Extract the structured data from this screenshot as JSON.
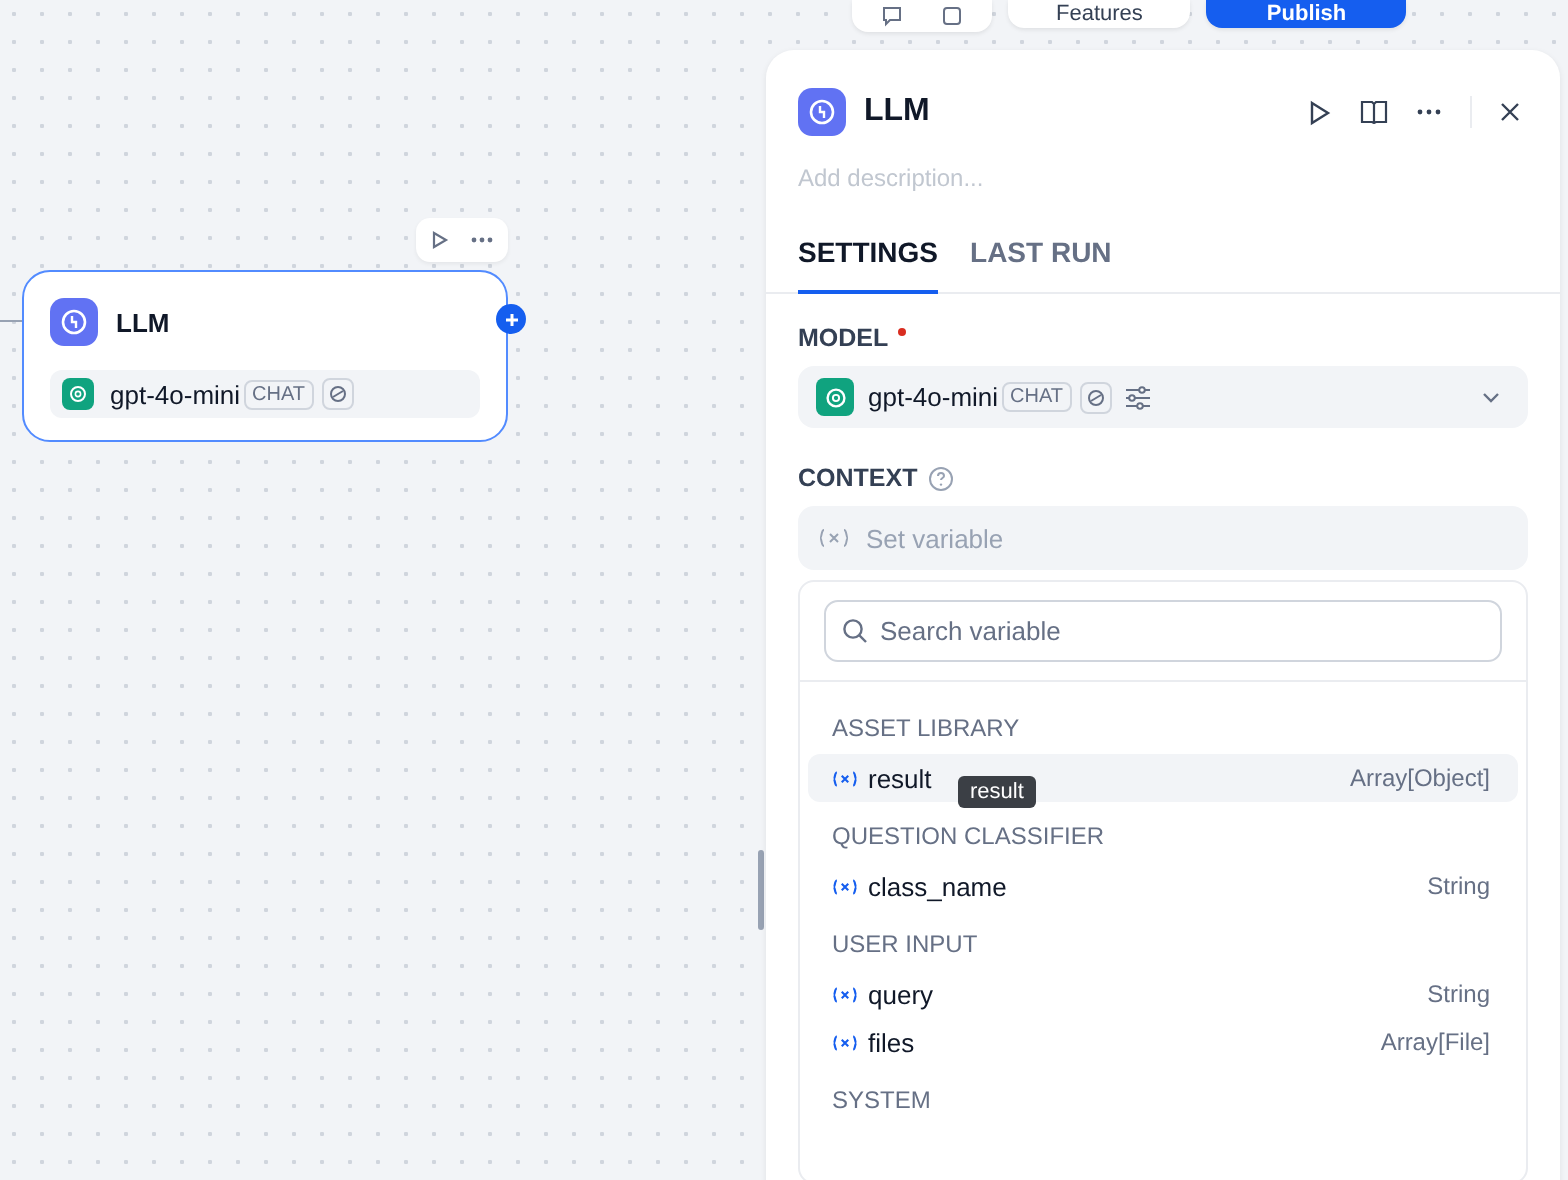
{
  "toolbar": {
    "features_label": "Features",
    "publish_label": "Publish"
  },
  "node": {
    "title": "LLM",
    "model": "gpt-4o-mini",
    "model_mode": "CHAT"
  },
  "panel": {
    "title": "LLM",
    "description_placeholder": "Add description...",
    "tabs": [
      {
        "label": "SETTINGS",
        "selected": true
      },
      {
        "label": "LAST RUN",
        "selected": false
      }
    ],
    "model_label": "MODEL",
    "model_required": true,
    "model": "gpt-4o-mini",
    "model_mode": "CHAT",
    "context_label": "CONTEXT",
    "context_placeholder": "Set variable",
    "variable_picker": {
      "search_placeholder": "Search variable",
      "groups": [
        {
          "title": "ASSET LIBRARY",
          "items": [
            {
              "name": "result",
              "type": "Array[Object]",
              "selected": true
            }
          ]
        },
        {
          "title": "QUESTION CLASSIFIER",
          "items": [
            {
              "name": "class_name",
              "type": "String",
              "selected": false
            }
          ]
        },
        {
          "title": "USER INPUT",
          "items": [
            {
              "name": "query",
              "type": "String",
              "selected": false
            },
            {
              "name": "files",
              "type": "Array[File]",
              "selected": false
            }
          ]
        },
        {
          "title": "SYSTEM"
        }
      ],
      "tooltip": "result"
    }
  }
}
